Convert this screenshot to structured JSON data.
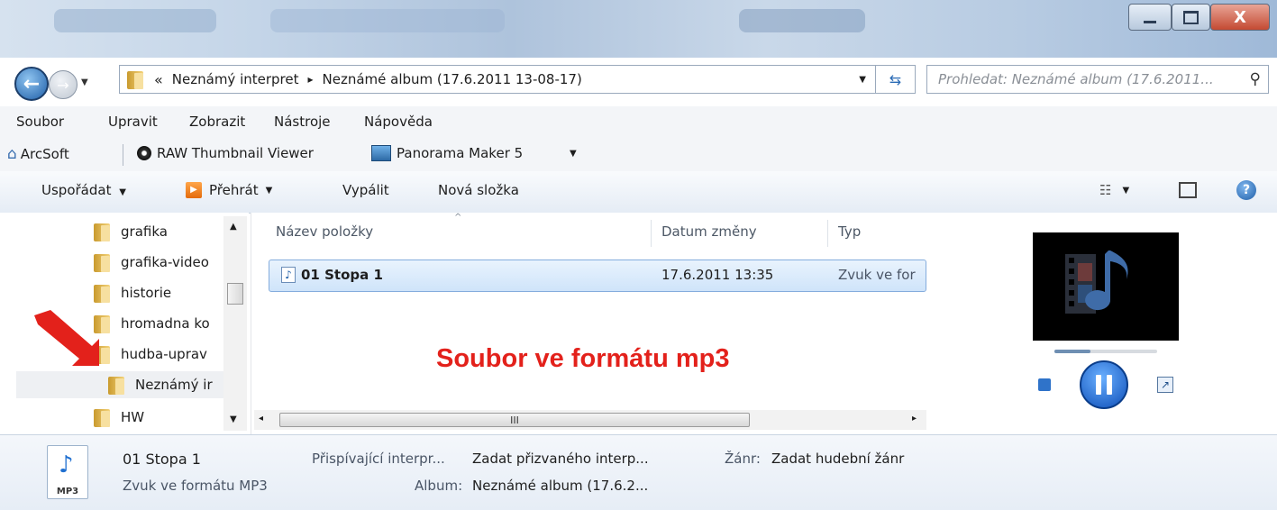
{
  "window": {
    "controls": {
      "minimize": "minimize-icon",
      "maximize": "maximize-icon",
      "close_label": "X"
    }
  },
  "address": {
    "overflow": "«",
    "crumbs": [
      "Neznámý interpret",
      "Neznámé album (17.6.2011 13-08-17)"
    ],
    "separator": "▸"
  },
  "search": {
    "placeholder": "Prohledat: Neznámé album (17.6.2011..."
  },
  "menu": [
    "Soubor",
    "Upravit",
    "Zobrazit",
    "Nástroje",
    "Nápověda"
  ],
  "links": [
    "ArcSoft",
    "RAW Thumbnail Viewer",
    "Panorama Maker 5"
  ],
  "commands": {
    "organize": "Uspořádat",
    "play": "Přehrát",
    "burn": "Vypálit",
    "new_folder": "Nová složka"
  },
  "tree": [
    "grafika",
    "grafika-video",
    "historie",
    "hromadna ko",
    "hudba-uprav",
    "Neznámý ir",
    "HW"
  ],
  "columns": {
    "name": "Název položky",
    "date": "Datum změny",
    "type": "Typ"
  },
  "files": [
    {
      "name": "01 Stopa 1",
      "date": "17.6.2011 13:35",
      "type": "Zvuk ve for"
    }
  ],
  "scrollbar_grip": "III",
  "annotation": {
    "text": "Soubor ve formátu mp3",
    "color": "#e3211b"
  },
  "details": {
    "filename": "01 Stopa 1",
    "filetype": "Zvuk ve formátu MP3",
    "icon_label": "MP3",
    "contributing_label": "Přispívající interpr...",
    "contributing_value": "Zadat přizvaného interp...",
    "album_label": "Album:",
    "album_value": "Neznámé album (17.6.2...",
    "genre_label": "Žánr:",
    "genre_value": "Zadat hudební žánr"
  }
}
